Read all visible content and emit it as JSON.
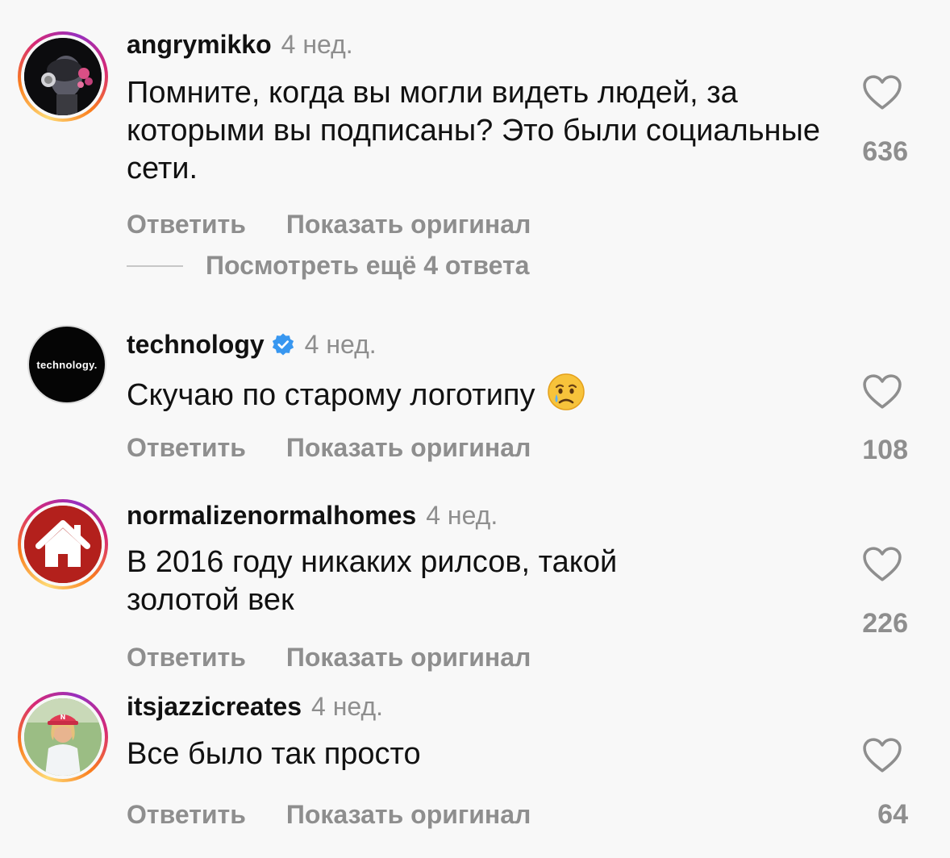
{
  "reply_label": "Ответить",
  "show_original_label": "Показать оригинал",
  "comments": [
    {
      "username": "angrymikko",
      "time": "4 нед.",
      "text": "Помните, когда вы могли видеть людей, за которыми вы подписаны? Это были социальные сети.",
      "likes": "636",
      "view_replies": "Посмотреть ещё 4 ответа"
    },
    {
      "username": "technology",
      "verified": true,
      "time": "4 нед.",
      "text": "Скучаю по старому логотипу",
      "emoji": "crying-face",
      "avatar_text": "technology.",
      "likes": "108"
    },
    {
      "username": "normalizenormalhomes",
      "time": "4 нед.",
      "text": "В 2016 году никаких рилсов, такой золотой век",
      "likes": "226"
    },
    {
      "username": "itsjazzicreates",
      "time": "4 нед.",
      "text": "Все было так просто",
      "likes": "64"
    }
  ],
  "colors": {
    "background": "#f8f8f8",
    "muted_text": "#8e8e8e",
    "verified_blue": "#3897f0",
    "house_red": "#b3201c"
  }
}
